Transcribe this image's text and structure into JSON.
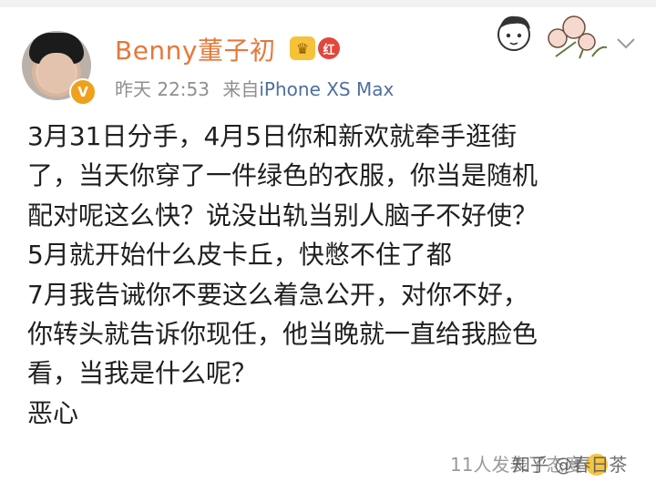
{
  "header": {
    "username": "Benny董子初",
    "verify_mark": "V",
    "level_badge": "红",
    "crown_icon": "crown-icon",
    "time": "昨天 22:53",
    "source_prefix": "来自",
    "device": "iPhone XS Max"
  },
  "post": {
    "lines": [
      "3月31日分手，4月5日你和新欢就牵手逛街",
      "了，当天你穿了一件绿色的衣服，你当是随机",
      "配对呢这么快？说没出轨当别人脑子不好使？",
      "5月就开始什么皮卡丘，快憋不住了都",
      "7月我告诫你不要这么着急公开，对你不好，",
      "你转头就告诉你现任，他当晚就一直给我脸色",
      "看，当我是什么呢？",
      "恶心"
    ]
  },
  "footer": {
    "likes_text": "11人发表了态度"
  },
  "watermark": "知乎 @春日茶",
  "colors": {
    "username": "#e4793a",
    "meta": "#8f8f8f",
    "device": "#4e6fa0",
    "badge_orange": "#f0a01a",
    "badge_red": "#e2463d"
  }
}
